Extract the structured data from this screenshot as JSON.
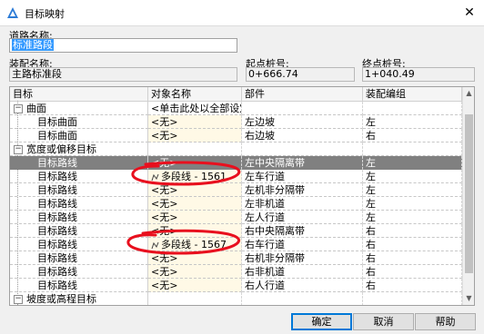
{
  "window": {
    "title": "目标映射",
    "close_glyph": "✕"
  },
  "road_name": {
    "label": "道路名称:",
    "value": "标准路段"
  },
  "assembly_name": {
    "label": "装配名称:",
    "value": "主路标准段"
  },
  "start_station": {
    "label": "起点桩号:",
    "value": "0+666.74"
  },
  "end_station": {
    "label": "终点桩号:",
    "value": "1+040.49"
  },
  "grid": {
    "headers": {
      "target": "目标",
      "object": "对象名称",
      "part": "部件",
      "code": "装配编组"
    },
    "rows": [
      {
        "kind": "group",
        "expander": "−",
        "target": "曲面",
        "object": "<单击此处以全部设定>",
        "part": "",
        "code": ""
      },
      {
        "kind": "item",
        "target": "目标曲面",
        "object": "<无>",
        "part": "左边坡",
        "code": "左"
      },
      {
        "kind": "item",
        "target": "目标曲面",
        "object": "<无>",
        "part": "右边坡",
        "code": "右"
      },
      {
        "kind": "group",
        "expander": "−",
        "target": "宽度或偏移目标",
        "object": "",
        "part": "",
        "code": ""
      },
      {
        "kind": "item",
        "selected": true,
        "target": "目标路线",
        "object": "<无>",
        "part": "左中央隔离带",
        "code": "左"
      },
      {
        "kind": "item",
        "polyline": true,
        "target": "目标路线",
        "object": "多段线 - 1561",
        "part": "左车行道",
        "code": "左"
      },
      {
        "kind": "item",
        "target": "目标路线",
        "object": "<无>",
        "part": "左机非分隔带",
        "code": "左"
      },
      {
        "kind": "item",
        "target": "目标路线",
        "object": "<无>",
        "part": "左非机道",
        "code": "左"
      },
      {
        "kind": "item",
        "target": "目标路线",
        "object": "<无>",
        "part": "左人行道",
        "code": "左"
      },
      {
        "kind": "item",
        "target": "目标路线",
        "object": "<无>",
        "part": "右中央隔离带",
        "code": "右"
      },
      {
        "kind": "item",
        "polyline": true,
        "target": "目标路线",
        "object": "多段线 - 1567",
        "part": "右车行道",
        "code": "右"
      },
      {
        "kind": "item",
        "target": "目标路线",
        "object": "<无>",
        "part": "右机非分隔带",
        "code": "右"
      },
      {
        "kind": "item",
        "target": "目标路线",
        "object": "<无>",
        "part": "右非机道",
        "code": "右"
      },
      {
        "kind": "item",
        "target": "目标路线",
        "object": "<无>",
        "part": "右人行道",
        "code": "右"
      },
      {
        "kind": "group",
        "expander": "−",
        "target": "坡度或高程目标",
        "object": "",
        "part": "",
        "code": ""
      }
    ]
  },
  "buttons": {
    "ok": "确定",
    "cancel": "取消",
    "help": "帮助"
  },
  "colors": {
    "annotation_red": "#e8101e",
    "selection_gray": "#808080",
    "object_column_bg": "#fff9e6"
  }
}
